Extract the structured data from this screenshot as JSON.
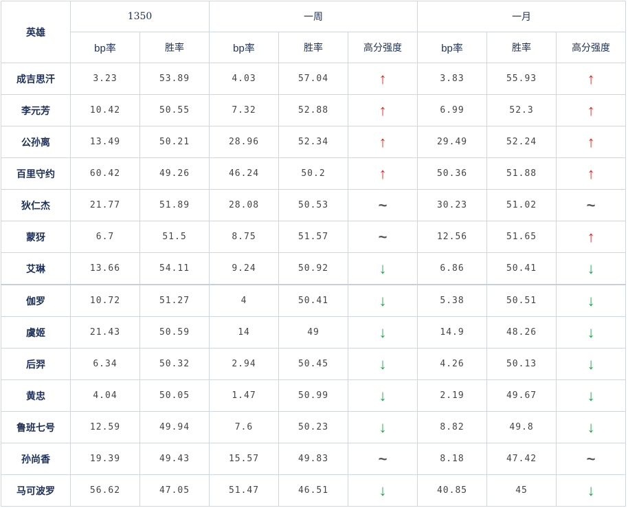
{
  "header": {
    "hero_col": "英雄",
    "groups": [
      {
        "label": "1350",
        "cols": [
          "bp率",
          "胜率"
        ]
      },
      {
        "label": "一周",
        "cols": [
          "bp率",
          "胜率",
          "高分强度"
        ]
      },
      {
        "label": "一月",
        "cols": [
          "bp率",
          "胜率",
          "高分强度"
        ]
      }
    ]
  },
  "rows": [
    {
      "hero": "成吉思汗",
      "v": [
        "3.23",
        "53.89",
        "4.03",
        "57.04",
        "3.83",
        "55.93"
      ],
      "t": [
        "up",
        "up"
      ]
    },
    {
      "hero": "李元芳",
      "v": [
        "10.42",
        "50.55",
        "7.32",
        "52.88",
        "6.99",
        "52.3"
      ],
      "t": [
        "up",
        "up"
      ]
    },
    {
      "hero": "公孙离",
      "v": [
        "13.49",
        "50.21",
        "28.96",
        "52.34",
        "29.49",
        "52.24"
      ],
      "t": [
        "up",
        "up"
      ]
    },
    {
      "hero": "百里守约",
      "v": [
        "60.42",
        "49.26",
        "46.24",
        "50.2",
        "50.36",
        "51.88"
      ],
      "t": [
        "up",
        "up"
      ]
    },
    {
      "hero": "狄仁杰",
      "v": [
        "21.77",
        "51.89",
        "28.08",
        "50.53",
        "30.23",
        "51.02"
      ],
      "t": [
        "flat",
        "flat"
      ]
    },
    {
      "hero": "蒙犽",
      "v": [
        "6.7",
        "51.5",
        "8.75",
        "51.57",
        "12.56",
        "51.65"
      ],
      "t": [
        "flat",
        "up"
      ]
    },
    {
      "hero": "艾琳",
      "v": [
        "13.66",
        "54.11",
        "9.24",
        "50.92",
        "6.86",
        "50.41"
      ],
      "t": [
        "down",
        "down"
      ]
    },
    {
      "hero": "伽罗",
      "v": [
        "10.72",
        "51.27",
        "4",
        "50.41",
        "5.38",
        "50.51"
      ],
      "t": [
        "down",
        "down"
      ]
    },
    {
      "hero": "虞姬",
      "v": [
        "21.43",
        "50.59",
        "14",
        "49",
        "14.9",
        "48.26"
      ],
      "t": [
        "down",
        "down"
      ]
    },
    {
      "hero": "后羿",
      "v": [
        "6.34",
        "50.32",
        "2.94",
        "50.45",
        "4.26",
        "50.13"
      ],
      "t": [
        "down",
        "down"
      ]
    },
    {
      "hero": "黄忠",
      "v": [
        "4.04",
        "50.05",
        "1.47",
        "50.99",
        "2.19",
        "49.67"
      ],
      "t": [
        "down",
        "down"
      ]
    },
    {
      "hero": "鲁班七号",
      "v": [
        "12.59",
        "49.94",
        "7.6",
        "50.23",
        "8.82",
        "49.8"
      ],
      "t": [
        "down",
        "down"
      ]
    },
    {
      "hero": "孙尚香",
      "v": [
        "19.39",
        "49.43",
        "15.57",
        "49.83",
        "8.18",
        "47.42"
      ],
      "t": [
        "flat",
        "flat"
      ]
    },
    {
      "hero": "马可波罗",
      "v": [
        "56.62",
        "47.05",
        "51.47",
        "46.51",
        "40.85",
        "45"
      ],
      "t": [
        "down",
        "down"
      ]
    }
  ],
  "trend_glyphs": {
    "up": "↑",
    "down": "↓",
    "flat": "~"
  },
  "trend_colors": {
    "up": "#e8231f",
    "down": "#1fa64a",
    "flat": "#555555"
  }
}
